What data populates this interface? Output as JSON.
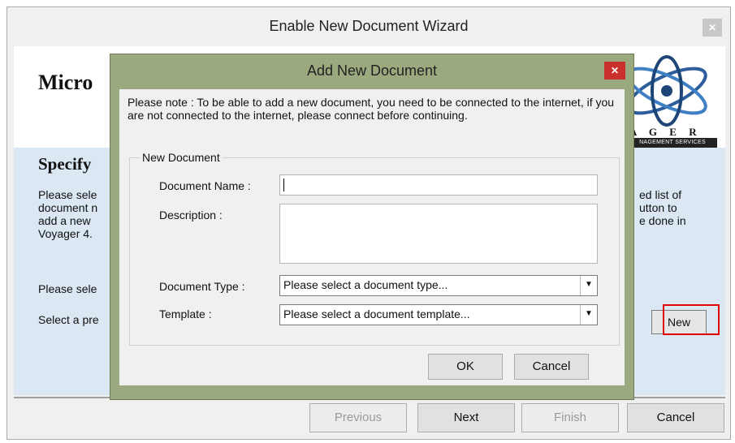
{
  "wizard": {
    "title": "Enable New Document Wizard",
    "close_icon": "close-icon",
    "brand_text": "Micro",
    "logo": {
      "letters": "A G E R",
      "services": "NAGEMENT SERVICES"
    },
    "heading": "Specify",
    "paragraph_left": "Please sele\ndocument n\nadd a new\nVoyager 4.",
    "paragraph_right": "ed list of\nutton to\ne done in",
    "line1": "Please sele",
    "line2": "Select a pre",
    "new_button": "New",
    "footer": {
      "previous": "Previous",
      "next": "Next",
      "finish": "Finish",
      "cancel": "Cancel"
    }
  },
  "dialog": {
    "title": "Add New Document",
    "close_icon": "close-icon",
    "note": "Please note : To be able to add a new document, you need to be connected to the internet, if you are not connected to the internet, please connect before continuing.",
    "group_label": "New Document",
    "fields": {
      "name_label": "Document Name :",
      "name_value": "",
      "description_label": "Description :",
      "description_value": "",
      "type_label": "Document Type :",
      "type_value": "Please select a document type...",
      "template_label": "Template :",
      "template_value": "Please select a document template..."
    },
    "ok": "OK",
    "cancel": "Cancel"
  },
  "colors": {
    "dialog_frame": "#9aaa7e",
    "body_panel": "#dbe7f3",
    "highlight": "#e00000",
    "close_button": "#c9302c"
  }
}
